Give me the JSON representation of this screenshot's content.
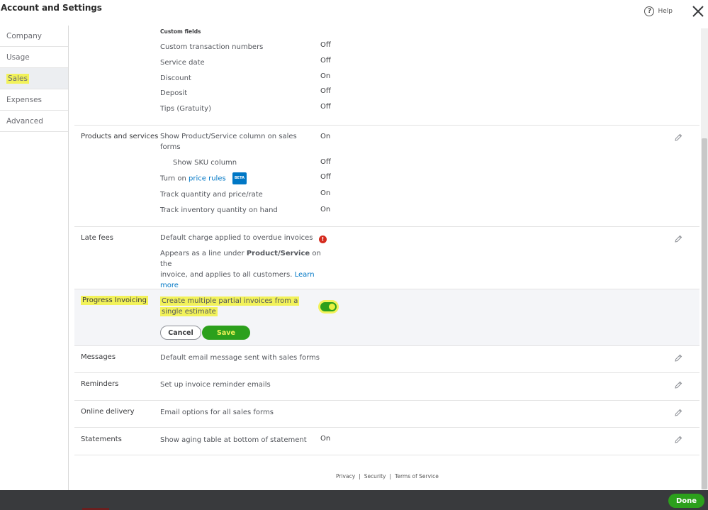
{
  "header": {
    "title": "Account and Settings",
    "help_glyph": "?",
    "help_label": "Help"
  },
  "sidebar": {
    "items": [
      {
        "label": "Company"
      },
      {
        "label": "Usage"
      },
      {
        "label": "Sales"
      },
      {
        "label": "Expenses"
      },
      {
        "label": "Advanced"
      }
    ],
    "active": "Sales"
  },
  "custom_fields": {
    "heading": "Custom fields",
    "rows": [
      {
        "label": "Custom transaction numbers",
        "value": "Off"
      },
      {
        "label": "Service date",
        "value": "Off"
      },
      {
        "label": "Discount",
        "value": "On"
      },
      {
        "label": "Deposit",
        "value": "Off"
      },
      {
        "label": "Tips (Gratuity)",
        "value": "Off"
      }
    ]
  },
  "products": {
    "label": "Products and services",
    "row1_line1": "Show Product/Service column on sales",
    "row1_line2": "forms",
    "row1_value": "On",
    "sku_label": "Show SKU column",
    "sku_value": "Off",
    "price_prefix": "Turn on",
    "price_link": "price rules",
    "price_badge": "BETA",
    "price_value": "Off",
    "track_qty_label": "Track quantity and price/rate",
    "track_qty_value": "On",
    "track_inv_label": "Track inventory quantity on hand",
    "track_inv_value": "On"
  },
  "late_fees": {
    "label": "Late fees",
    "row_label": "Default charge applied to overdue invoices",
    "error_glyph": "!",
    "desc_1": "Appears as a line under",
    "desc_bold": "Product/Service",
    "desc_2": "on the",
    "desc_3": "invoice, and applies to all customers.",
    "learn": "Learn",
    "more": "more"
  },
  "progress_invoicing": {
    "label": "Progress Invoicing",
    "desc_line1": "Create multiple partial invoices from a",
    "desc_line2": "single estimate",
    "toggle_on": true,
    "cancel_label": "Cancel",
    "save_label": "Save"
  },
  "messages": {
    "label": "Messages",
    "desc": "Default email message sent with sales forms"
  },
  "reminders": {
    "label": "Reminders",
    "desc": "Set up invoice reminder emails"
  },
  "online_delivery": {
    "label": "Online delivery",
    "desc": "Email options for all sales forms"
  },
  "statements": {
    "label": "Statements",
    "desc": "Show aging table at bottom of statement",
    "value": "On"
  },
  "footer": {
    "privacy": "Privacy",
    "security": "Security",
    "terms": "Terms of Service",
    "separator": "|"
  },
  "bottom": {
    "done_label": "Done"
  },
  "colors": {
    "accent_green": "#2ca01c",
    "link_blue": "#0077c5",
    "highlight": "#f2f25a",
    "error_red": "#d52b1e"
  },
  "icons": [
    "help-icon",
    "close-icon",
    "pencil-icon",
    "error-icon"
  ]
}
